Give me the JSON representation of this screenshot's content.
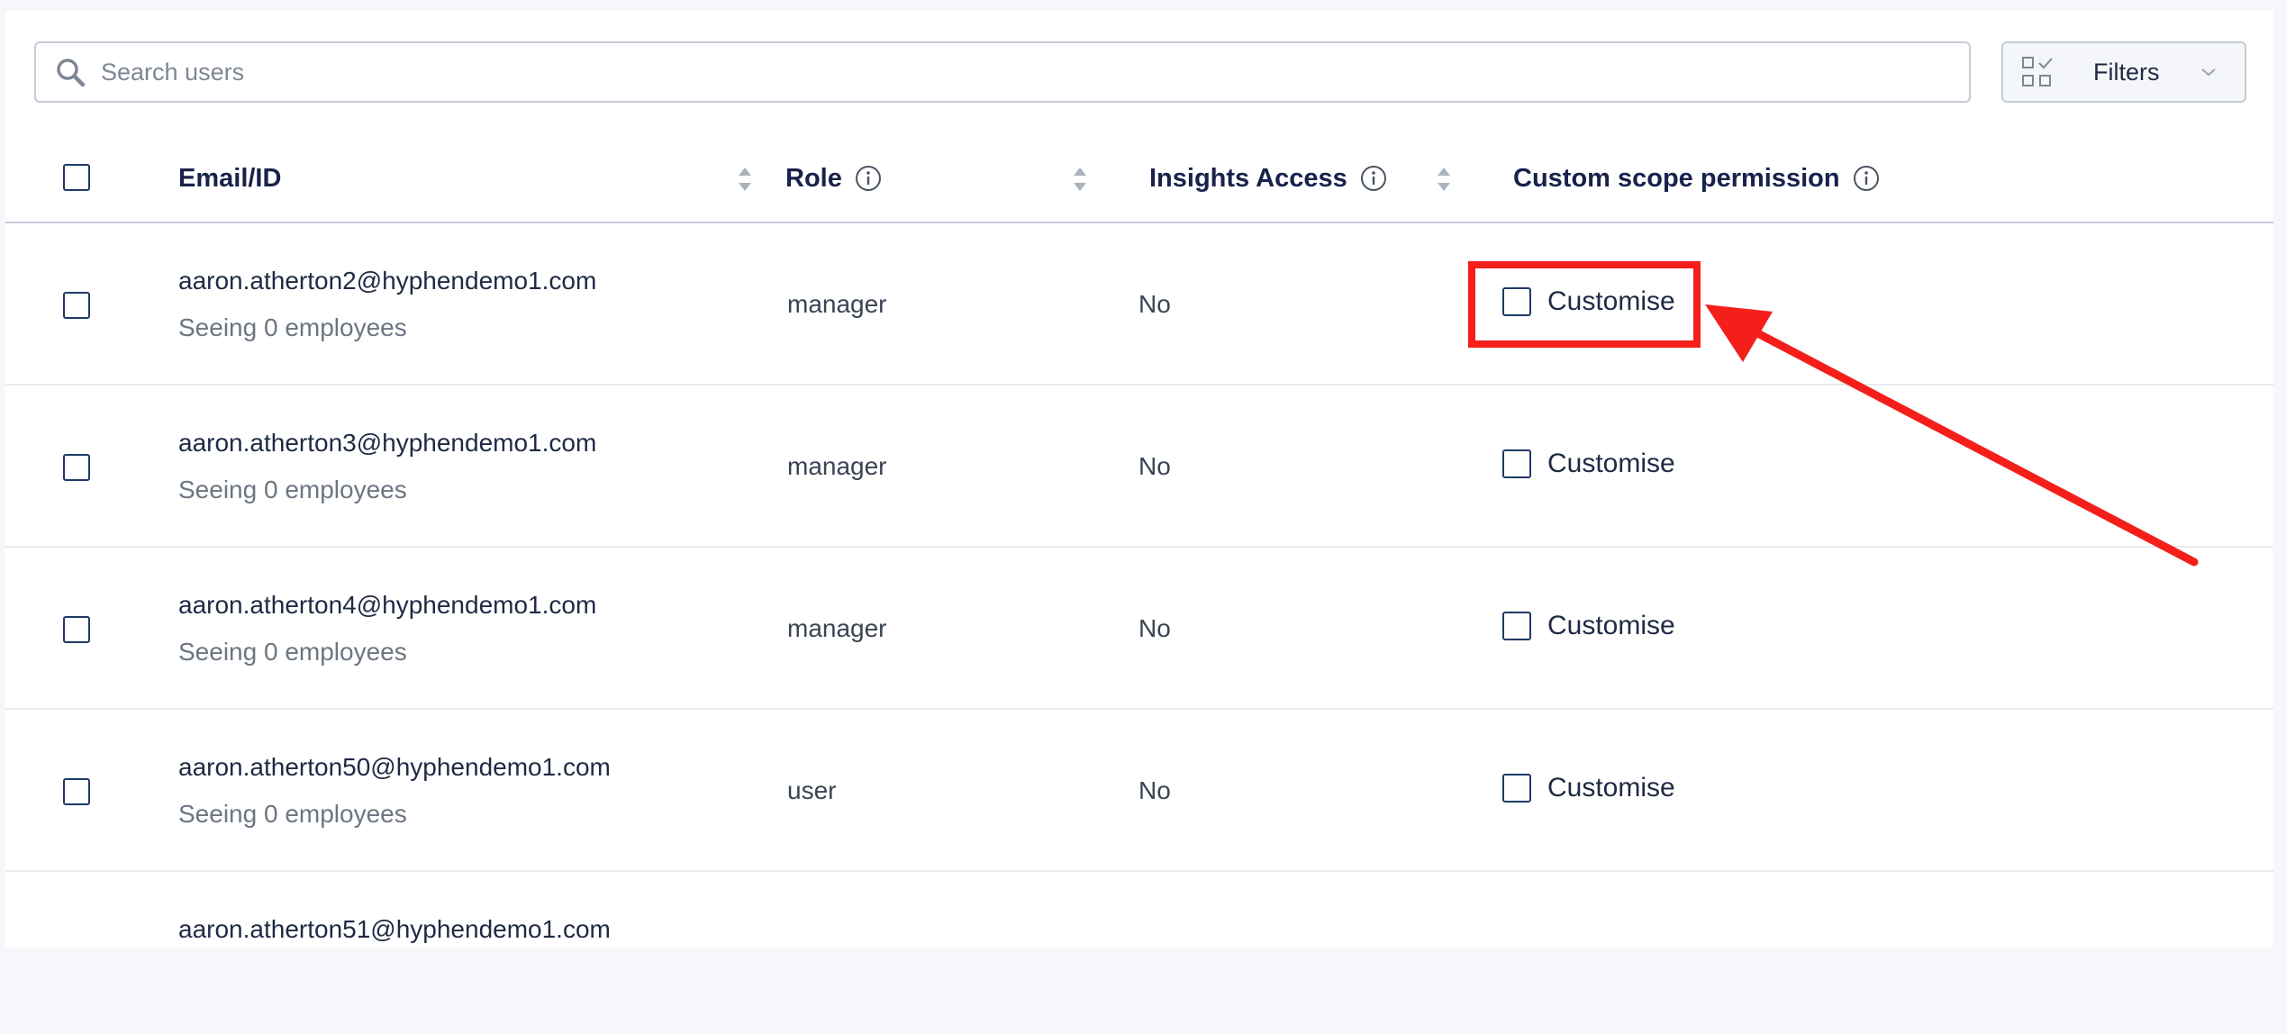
{
  "search": {
    "placeholder": "Search users",
    "value": ""
  },
  "filters": {
    "label": "Filters"
  },
  "table": {
    "columns": {
      "email": "Email/ID",
      "role": "Role",
      "insights": "Insights Access",
      "custom": "Custom scope permission"
    },
    "rows": [
      {
        "email": "aaron.atherton2@hyphendemo1.com",
        "seeing": "Seeing 0 employees",
        "role": "manager",
        "insights": "No",
        "custom_label": "Customise"
      },
      {
        "email": "aaron.atherton3@hyphendemo1.com",
        "seeing": "Seeing 0 employees",
        "role": "manager",
        "insights": "No",
        "custom_label": "Customise"
      },
      {
        "email": "aaron.atherton4@hyphendemo1.com",
        "seeing": "Seeing 0 employees",
        "role": "manager",
        "insights": "No",
        "custom_label": "Customise"
      },
      {
        "email": "aaron.atherton50@hyphendemo1.com",
        "seeing": "Seeing 0 employees",
        "role": "user",
        "insights": "No",
        "custom_label": "Customise"
      },
      {
        "email": "aaron.atherton51@hyphendemo1.com",
        "seeing": "",
        "role": "",
        "insights": "",
        "custom_label": ""
      }
    ]
  },
  "icons": {
    "search": "search-icon",
    "filters": "filter-grid-icon",
    "chevron": "chevron-down-icon",
    "info": "info-icon",
    "sort": "sort-icon"
  },
  "colors": {
    "annotation": "#f41f1b",
    "checkbox_border": "#1f3a66",
    "header_text": "#18224a"
  }
}
